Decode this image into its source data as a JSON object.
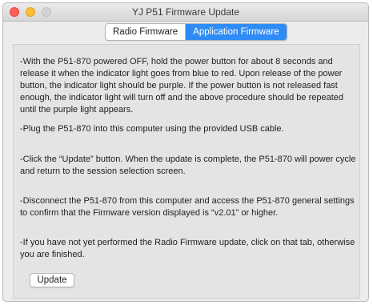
{
  "window": {
    "title": "YJ P51 Firmware Update"
  },
  "tabs": [
    {
      "label": "Radio Firmware",
      "active": false
    },
    {
      "label": "Application Firmware",
      "active": true
    }
  ],
  "instructions": [
    "-With the P51-870 powered OFF, hold the power button for about 8 seconds and release it when the indicator light goes from blue to red. Upon release of the power button, the indicator light should be purple. If the power button is not released fast enough, the indicator light will turn off and the above procedure should be repeated until the purple light appears.",
    "-Plug the P51-870 into this computer using the provided USB cable.",
    "-Click the “Update” button. When the update is complete, the P51-870 will power cycle and return to the session selection screen.",
    "-Disconnect the P51-870 from this computer and access the P51-870 general settings to confirm that the Firmware version displayed is “v2.01” or higher.",
    "-If you have not yet performed the Radio Firmware update, click on that tab, otherwise you are finished."
  ],
  "update_button": {
    "label": "Update"
  },
  "colors": {
    "accent": "#2f8cf5",
    "window_bg": "#ececec",
    "content_bg": "#e4e4e4"
  }
}
